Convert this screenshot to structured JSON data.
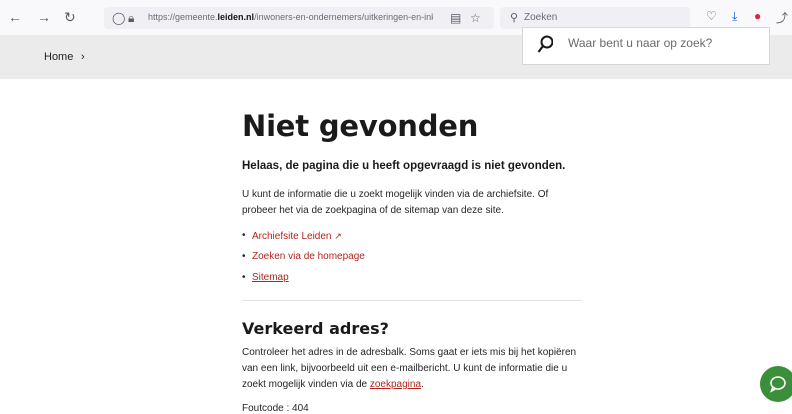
{
  "browser": {
    "url_prefix": "https://gemeente.",
    "url_domain": "leiden.nl",
    "url_path": "/inwoners-en-ondernemers/uitkeringen-en-inkome",
    "search_placeholder": "Zoeken"
  },
  "site": {
    "breadcrumb_home": "Home",
    "breadcrumb_sep": "›",
    "search_placeholder": "Waar bent u naar op zoek?"
  },
  "page": {
    "title": "Niet gevonden",
    "lead": "Helaas, de pagina die u heeft opgevraagd is niet gevonden.",
    "intro": "U kunt de informatie die u zoekt mogelijk vinden via de archiefsite. Of probeer het via de zoekpagina of de sitemap van deze site.",
    "links": [
      {
        "label": "Archiefsite Leiden",
        "external_mark": "↗"
      },
      {
        "label": "Zoeken via de homepage"
      },
      {
        "label": "Sitemap"
      }
    ],
    "section_title": "Verkeerd adres?",
    "section_text_before": "Controleer het adres in de adresbalk. Soms gaat er iets mis bij het kopiëren van een link, bijvoorbeeld uit een e-mailbericht. U kunt de informatie die u zoekt mogelijk vinden via de ",
    "section_link": "zoekpagina",
    "section_text_after": ".",
    "error_code": "Foutcode : 404"
  },
  "icons": {
    "back": "arrow-left-icon",
    "forward": "arrow-right-icon",
    "reload": "reload-icon",
    "chat": "chat-icon"
  },
  "colors": {
    "link": "#b3261e",
    "chat_button": "#3c8f3a",
    "header_bg": "#ebebeb"
  }
}
